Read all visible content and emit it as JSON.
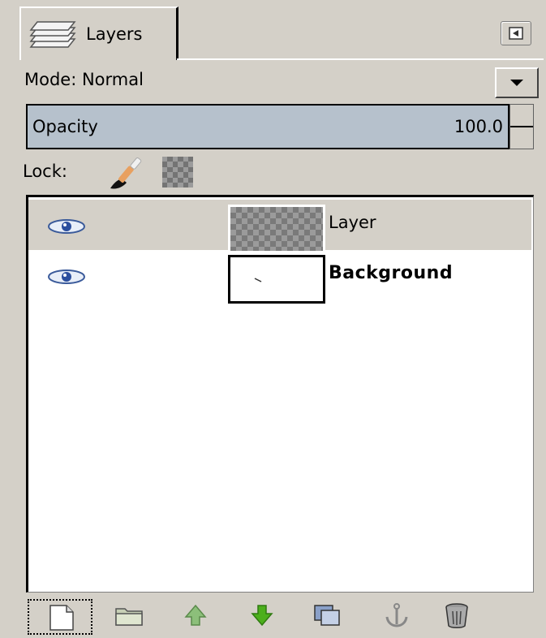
{
  "tab": {
    "label": "Layers"
  },
  "mode": {
    "label": "Mode: Normal"
  },
  "opacity": {
    "label": "Opacity",
    "value": "100.0",
    "fraction": 1.0
  },
  "lock": {
    "label": "Lock:"
  },
  "layers": [
    {
      "name": "Layer",
      "visible": true,
      "selected": true,
      "thumbnail": "transparent-checker"
    },
    {
      "name": "Background",
      "visible": true,
      "selected": false,
      "thumbnail": "white-with-stroke"
    }
  ],
  "toolbar": [
    {
      "icon": "new-layer-icon"
    },
    {
      "icon": "new-layer-group-icon"
    },
    {
      "icon": "raise-layer-icon"
    },
    {
      "icon": "lower-layer-icon"
    },
    {
      "icon": "duplicate-layer-icon"
    },
    {
      "icon": "anchor-layer-icon"
    },
    {
      "icon": "delete-layer-icon"
    }
  ],
  "colors": {
    "panel": "#d4d0c8",
    "opacity_fill": "#b6c1cc",
    "raise_green": "#8cbf7a",
    "lower_green": "#4caf1c"
  }
}
